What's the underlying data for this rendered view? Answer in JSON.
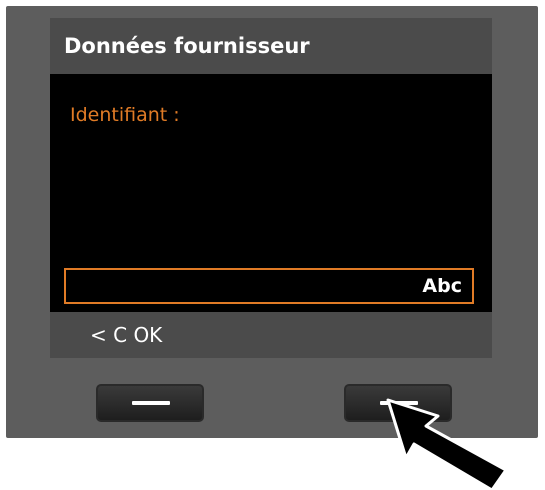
{
  "screen": {
    "title": "Données fournisseur",
    "field_label": "Identifiant :",
    "input_value": "",
    "input_mode": "Abc",
    "softkeys": "< C OK"
  },
  "colors": {
    "device_body": "#5d5d5d",
    "bar_background": "#4b4b4b",
    "screen_background": "#000000",
    "accent_orange": "#e07b26",
    "text_white": "#ffffff"
  },
  "icons": {
    "pointer": "arrow-pointer-icon",
    "key_mark": "dash-icon"
  }
}
